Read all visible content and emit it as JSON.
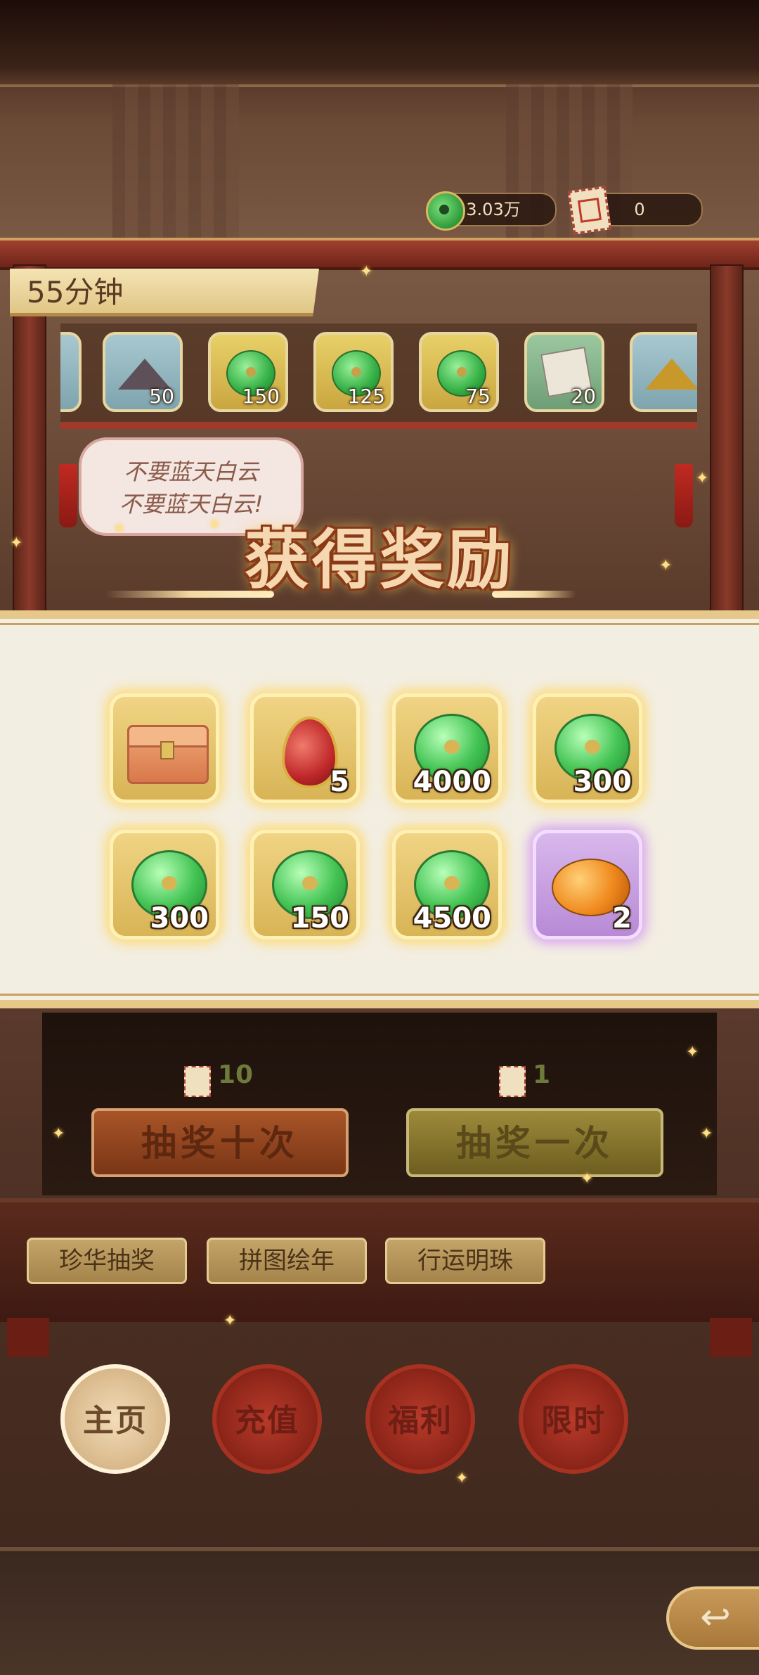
{
  "header": {
    "coin_amount": "3.03万",
    "ticket_amount": "0"
  },
  "board": {
    "timer": "55分钟",
    "speech": [
      "不要蓝天白云",
      "不要蓝天白云!"
    ],
    "shelf_items": [
      {
        "icon": "ore-pile-icon",
        "qty": "50"
      },
      {
        "icon": "jade-coin-icon",
        "qty": "150"
      },
      {
        "icon": "jade-coin-icon",
        "qty": "125"
      },
      {
        "icon": "jade-coin-icon",
        "qty": "75"
      },
      {
        "icon": "paper-scroll-icon",
        "qty": "20"
      }
    ]
  },
  "reward_dialog": {
    "title": "获得奖励",
    "items": [
      {
        "icon": "treasure-chest-icon",
        "qty": ""
      },
      {
        "icon": "red-pendant-icon",
        "qty": "5"
      },
      {
        "icon": "jade-coin-icon",
        "qty": "4000"
      },
      {
        "icon": "jade-coin-icon",
        "qty": "300"
      },
      {
        "icon": "jade-coin-icon",
        "qty": "300"
      },
      {
        "icon": "jade-coin-icon",
        "qty": "150"
      },
      {
        "icon": "jade-coin-icon",
        "qty": "4500"
      },
      {
        "icon": "amber-orb-icon",
        "qty": "2"
      }
    ]
  },
  "draw": {
    "ten_cost": "10",
    "one_cost": "1",
    "ten_label": "抽奖十次",
    "one_label": "抽奖一次"
  },
  "tabs": [
    "珍华抽奖",
    "拼图绘年",
    "行运明珠"
  ],
  "nav": [
    "主页",
    "充值",
    "福利",
    "限时"
  ],
  "colors": {
    "panel_bg": "#f3eee2",
    "gold_frame": "#e6c88a",
    "purple_frame": "#b88ad6",
    "jade": "#44c454"
  }
}
